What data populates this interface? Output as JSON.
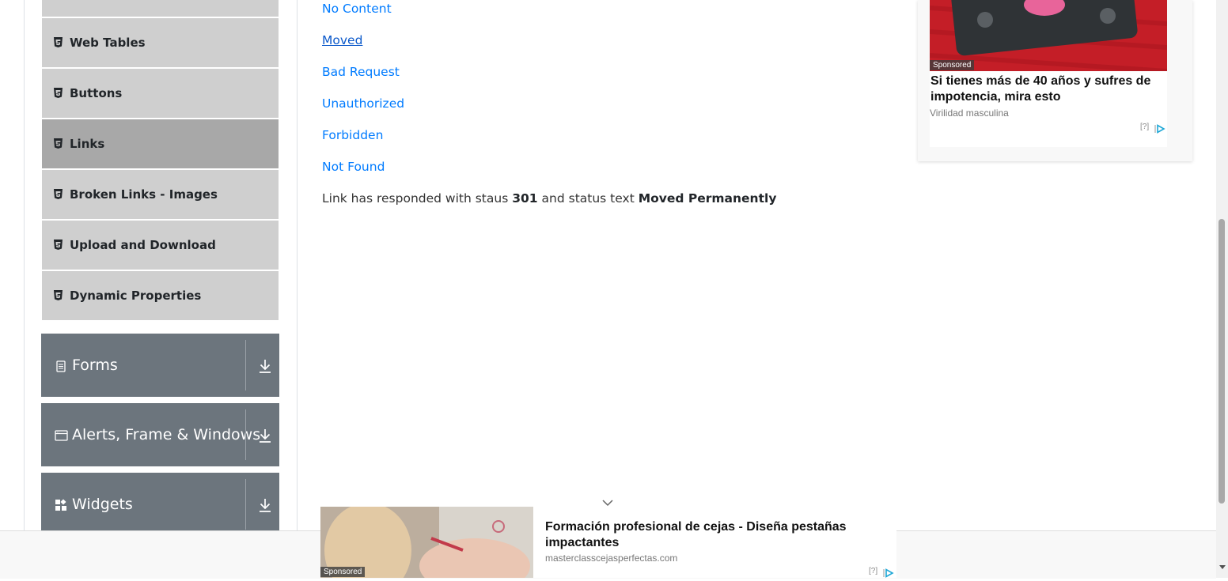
{
  "sidebar": {
    "items": [
      {
        "label": "Web Tables",
        "icon": "html5-icon"
      },
      {
        "label": "Buttons",
        "icon": "html5-icon"
      },
      {
        "label": "Links",
        "icon": "html5-icon",
        "active": true
      },
      {
        "label": "Broken Links - Images",
        "icon": "html5-icon"
      },
      {
        "label": "Upload and Download",
        "icon": "html5-icon"
      },
      {
        "label": "Dynamic Properties",
        "icon": "html5-icon"
      }
    ],
    "groups": [
      {
        "label": "Forms",
        "icon": "form-icon"
      },
      {
        "label": "Alerts, Frame & Windows",
        "icon": "window-icon"
      },
      {
        "label": "Widgets",
        "icon": "widgets-icon"
      }
    ]
  },
  "main": {
    "links": [
      "No Content",
      "Moved",
      "Bad Request",
      "Unauthorized",
      "Forbidden",
      "Not Found"
    ],
    "response": {
      "prefix": "Link has responded with staus",
      "status": "301",
      "middle": "and status text",
      "status_text": "Moved Permanently"
    }
  },
  "ads": {
    "right": {
      "sponsored": "Sponsored",
      "title": "Si tienes más de 40 años y sufres de impotencia, mira esto",
      "source": "Virilidad masculina",
      "choices": "[?]"
    },
    "bottom": {
      "sponsored": "Sponsored",
      "title": "Formación profesional de cejas - Diseña pestañas impactantes",
      "source": "masterclasscejasperfectas.com",
      "choices": "[?]"
    }
  },
  "colors": {
    "link": "#007bff",
    "sidebar_item": "#cfcfcf",
    "sidebar_active": "#a8a8a8",
    "group": "#6c757d"
  }
}
